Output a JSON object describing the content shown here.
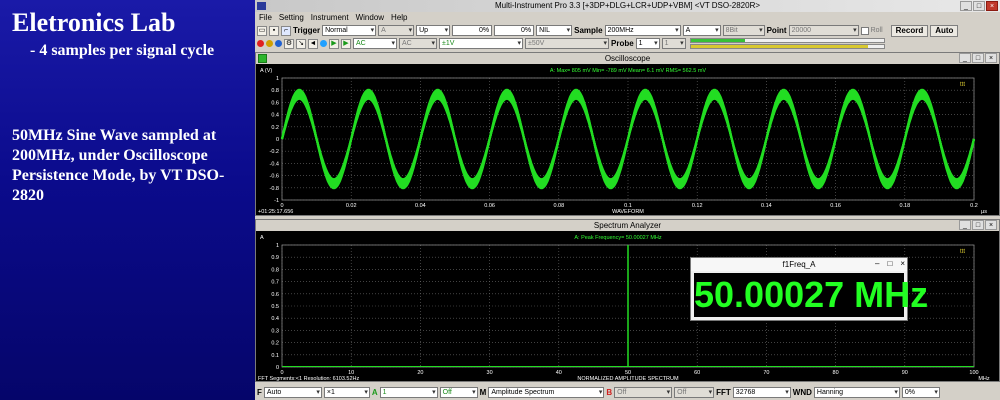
{
  "slide": {
    "title": "Eletronics Lab",
    "subtitle": "- 4 samples per signal cycle",
    "body": "50MHz Sine Wave sampled at 200MHz, under Oscilloscope Persistence Mode, by VT DSO-2820"
  },
  "app": {
    "title": "Multi-Instrument Pro 3.3    [+3DP+DLG+LCR+UDP+VBM]    <VT DSO-2820R>",
    "window_buttons": [
      "_",
      "□",
      "×"
    ]
  },
  "menu": [
    "File",
    "Setting",
    "Instrument",
    "Window",
    "Help"
  ],
  "toolbar1": {
    "trigger_label": "Trigger",
    "trigger_mode": "Normal",
    "trigger_channel": "A",
    "trigger_edge": "Up",
    "pct1": "0%",
    "pct2": "0%",
    "nil": "NIL",
    "sample_label": "Sample",
    "sample_rate": "200MHz",
    "channel": "A",
    "bits": "8Bit",
    "point_label": "Point",
    "points": "20000",
    "roll_label": "Roll",
    "record_label": "Record",
    "auto_label": "Auto"
  },
  "toolbar2": {
    "coupling_a": "AC",
    "coupling_b": "AC",
    "range_a": "±1V",
    "range_b": "±50V",
    "probe_label": "Probe",
    "probe_a": "1",
    "probe_b": "1",
    "progress_green": 0.28,
    "progress_yellow": 0.92
  },
  "oscilloscope": {
    "title": "Oscilloscope",
    "ylabel": "A (V)",
    "stats": "A: Max=   805 mV  Min=    -789 mV  Mean=       6.1 mV  RMS=    562.5 mV",
    "timestamp": "+01:25:17.656",
    "xlabel": "WAVEFORM",
    "xunit": "µs",
    "yticks": [
      "1",
      "0.8",
      "0.6",
      "0.4",
      "0.2",
      "0",
      "-0.2",
      "-0.4",
      "-0.6",
      "-0.8",
      "-1"
    ],
    "xticks": [
      "0",
      "0.02",
      "0.04",
      "0.06",
      "0.08",
      "0.1",
      "0.12",
      "0.14",
      "0.16",
      "0.18",
      "0.2"
    ],
    "signal_freq_mhz": 50,
    "amplitude_max_v": 0.805,
    "amplitude_min_v": -0.789,
    "trace_color": "#22dd22"
  },
  "spectrum": {
    "title": "Spectrum Analyzer",
    "ylabel": "A",
    "peak_text": "A: Peak Frequency=  50.00027 MHz",
    "footer_left": "FFT Segments:<1      Resolution:  6103.52Hz",
    "xlabel": "NORMALIZED AMPLITUDE SPECTRUM",
    "xunit": "MHz",
    "yticks": [
      "1",
      "0.9",
      "0.8",
      "0.7",
      "0.6",
      "0.5",
      "0.4",
      "0.3",
      "0.2",
      "0.1",
      "0"
    ],
    "xticks": [
      "0",
      "10",
      "20",
      "30",
      "40",
      "50",
      "60",
      "70",
      "80",
      "90",
      "100"
    ],
    "peak_mhz": 50.00027,
    "peak_amplitude": 1,
    "trace_color": "#22dd22"
  },
  "freq_window": {
    "title": "f1Freq_A",
    "value": "50.00027 MHz",
    "buttons": [
      "–",
      "□",
      "×"
    ]
  },
  "bottombar": {
    "f_label": "F",
    "f_value": "Auto",
    "mult": "×1",
    "a_label": "A",
    "a_value": "1",
    "a_opt": "Off",
    "m_label": "M",
    "m_value": "Amplitude Spectrum",
    "b_label": "B",
    "b_value": "Off",
    "off3": "Off",
    "fft_label": "FFT",
    "fft_value": "32768",
    "wnd_label": "WND",
    "wnd_value": "Hanning",
    "pct": "0%"
  },
  "colors": {
    "grid": "#6a6a6a",
    "trace": "#22dd22",
    "axis_text": "#ffffff",
    "stats_text": "#33ff33"
  }
}
